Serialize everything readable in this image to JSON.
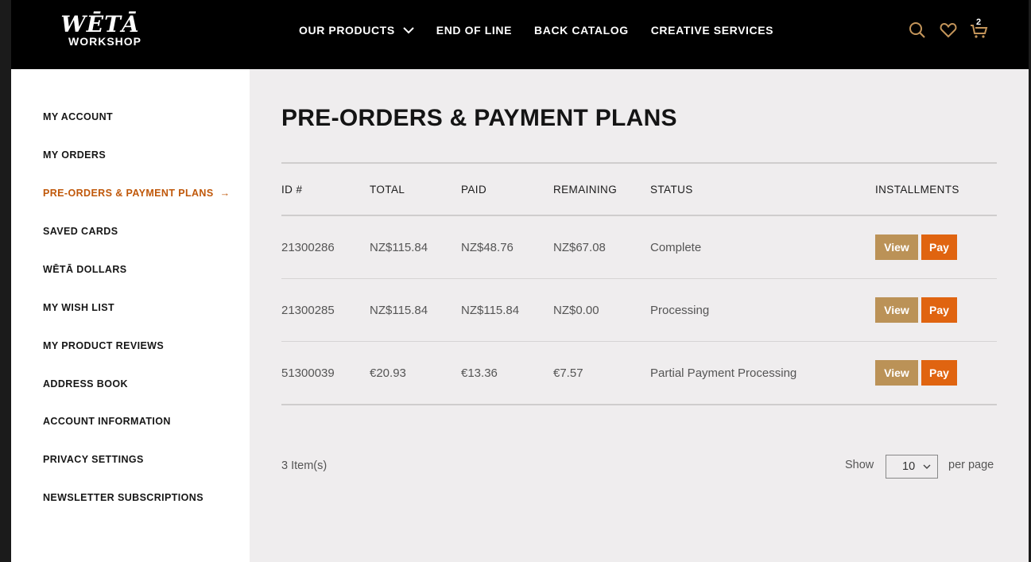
{
  "header": {
    "logo_top": "WĒTĀ",
    "logo_bottom": "WORKSHOP",
    "nav": [
      {
        "label": "OUR PRODUCTS",
        "has_dropdown": true
      },
      {
        "label": "END OF LINE"
      },
      {
        "label": "BACK CATALOG"
      },
      {
        "label": "CREATIVE SERVICES"
      }
    ],
    "cart_count": "2",
    "icons": [
      "search-icon",
      "heart-icon",
      "cart-icon"
    ],
    "icon_color": "#c4955a"
  },
  "sidebar": {
    "items": [
      {
        "label": "MY ACCOUNT"
      },
      {
        "label": "MY ORDERS"
      },
      {
        "label": "PRE-ORDERS & PAYMENT PLANS",
        "active": true
      },
      {
        "label": "SAVED CARDS"
      },
      {
        "label": "WĒTĀ DOLLARS"
      },
      {
        "label": "MY WISH LIST"
      },
      {
        "label": "MY PRODUCT REVIEWS"
      },
      {
        "label": "ADDRESS BOOK"
      },
      {
        "label": "ACCOUNT INFORMATION"
      },
      {
        "label": "PRIVACY SETTINGS"
      },
      {
        "label": "NEWSLETTER SUBSCRIPTIONS"
      }
    ],
    "active_arrow": "→",
    "active_color": "#c0580a"
  },
  "main": {
    "title": "PRE-ORDERS & PAYMENT PLANS",
    "columns": [
      "ID #",
      "TOTAL",
      "PAID",
      "REMAINING",
      "STATUS",
      "INSTALLMENTS"
    ],
    "rows": [
      {
        "id": "21300286",
        "total": "NZ$115.84",
        "paid": "NZ$48.76",
        "remaining": "NZ$67.08",
        "status": "Complete",
        "view": "View",
        "pay": "Pay"
      },
      {
        "id": "21300285",
        "total": "NZ$115.84",
        "paid": "NZ$115.84",
        "remaining": "NZ$0.00",
        "status": "Processing",
        "view": "View",
        "pay": "Pay"
      },
      {
        "id": "51300039",
        "total": "€20.93",
        "paid": "€13.36",
        "remaining": "€7.57",
        "status": "Partial Payment Processing",
        "view": "View",
        "pay": "Pay"
      }
    ],
    "item_count": "3 Item(s)",
    "show_label": "Show",
    "per_page_value": "10",
    "per_page_label": "per page",
    "view_color": "#bb9257",
    "pay_color": "#e06410"
  }
}
